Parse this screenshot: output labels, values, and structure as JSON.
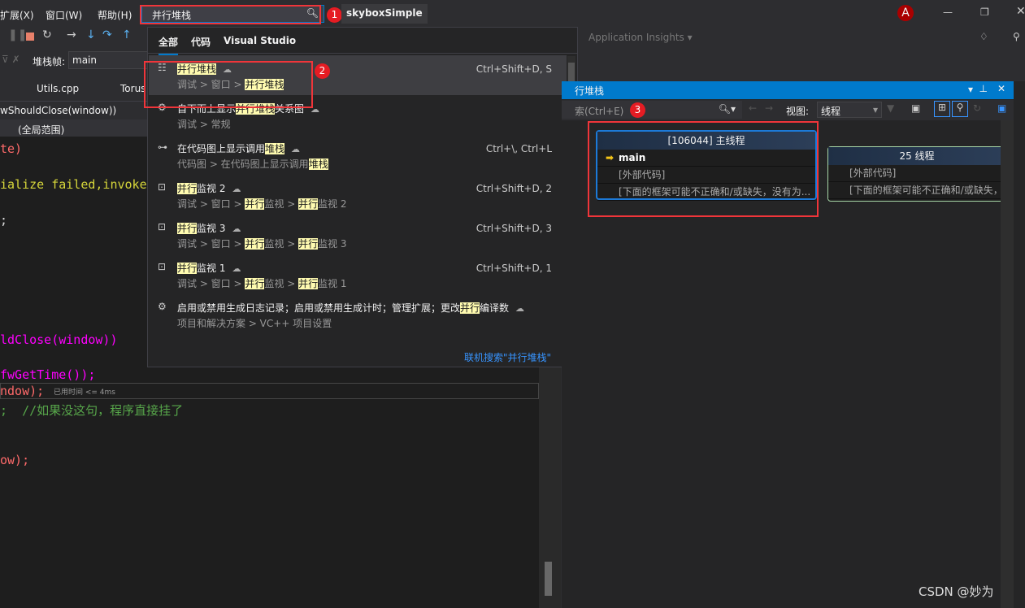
{
  "menu": {
    "items": [
      "扩展(X)",
      "窗口(W)",
      "帮助(H)"
    ]
  },
  "search": {
    "value": "并行堆栈",
    "badge": "1"
  },
  "solution_name": "skyboxSimple",
  "user_avatar": "A",
  "app_insights": "Application Insights",
  "stack_frame": {
    "label": "堆栈帧:",
    "value": "main"
  },
  "editor_tabs": [
    "Utils.cpp",
    "Torus"
  ],
  "nav": {
    "function": "wShouldClose(window))",
    "scope": "(全局范围)"
  },
  "code_lines": [
    {
      "text": "te)",
      "color": "#ff6a6a"
    },
    {
      "text": "ialize failed,invoke",
      "color": "#d6d63a"
    },
    {
      "text": ";",
      "color": "#dcdcdc"
    },
    {
      "text": "ldClose(window))",
      "color": "#ff00ff"
    },
    {
      "text": "fwGetTime());",
      "color": "#ff00ff"
    },
    {
      "text": "ndow);",
      "color": "#ff6a6a"
    },
    {
      "text": ";  //如果没这句，程序直接挂了",
      "color": "#57a64a"
    },
    {
      "text": "ow);",
      "color": "#ff6a6a"
    }
  ],
  "perf_tip": "已用时间 <= 4ms",
  "popup": {
    "tabs": [
      "全部",
      "代码",
      "Visual Studio"
    ],
    "badge": "2",
    "items": [
      {
        "icon": "parallel-stacks-icon",
        "title": [
          {
            "t": "并行堆栈",
            "h": true
          }
        ],
        "path": [
          {
            "t": "调试 > 窗口 > "
          },
          {
            "t": "并行堆栈",
            "h": true
          }
        ],
        "shortcut": "Ctrl+Shift+D, S"
      },
      {
        "icon": "gear-icon",
        "title": [
          {
            "t": "自下而上显示"
          },
          {
            "t": "并行堆栈",
            "h": true
          },
          {
            "t": "关系图"
          }
        ],
        "path": [
          {
            "t": "调试 > 常规"
          }
        ],
        "shortcut": ""
      },
      {
        "icon": "code-map-icon",
        "title": [
          {
            "t": "在代码图上显示调用"
          },
          {
            "t": "堆栈",
            "h": true
          }
        ],
        "path": [
          {
            "t": "代码图 > 在代码图上显示调用"
          },
          {
            "t": "堆栈",
            "h": true
          }
        ],
        "shortcut": "Ctrl+\\, Ctrl+L"
      },
      {
        "icon": "parallel-watch-icon",
        "title": [
          {
            "t": "并行",
            "h": true
          },
          {
            "t": "监视 2"
          }
        ],
        "path": [
          {
            "t": "调试 > 窗口 > "
          },
          {
            "t": "并行",
            "h": true
          },
          {
            "t": "监视 > "
          },
          {
            "t": "并行",
            "h": true
          },
          {
            "t": "监视 2"
          }
        ],
        "shortcut": "Ctrl+Shift+D, 2"
      },
      {
        "icon": "parallel-watch-icon",
        "title": [
          {
            "t": "并行",
            "h": true
          },
          {
            "t": "监视 3"
          }
        ],
        "path": [
          {
            "t": "调试 > 窗口 > "
          },
          {
            "t": "并行",
            "h": true
          },
          {
            "t": "监视 > "
          },
          {
            "t": "并行",
            "h": true
          },
          {
            "t": "监视 3"
          }
        ],
        "shortcut": "Ctrl+Shift+D, 3"
      },
      {
        "icon": "parallel-watch-icon",
        "title": [
          {
            "t": "并行",
            "h": true
          },
          {
            "t": "监视 1"
          }
        ],
        "path": [
          {
            "t": "调试 > 窗口 > "
          },
          {
            "t": "并行",
            "h": true
          },
          {
            "t": "监视 > "
          },
          {
            "t": "并行",
            "h": true
          },
          {
            "t": "监视 1"
          }
        ],
        "shortcut": "Ctrl+Shift+D, 1"
      },
      {
        "icon": "gear-icon",
        "title": [
          {
            "t": "启用或禁用生成日志记录；启用或禁用生成计时；管理扩展；更改"
          },
          {
            "t": "并行",
            "h": true
          },
          {
            "t": "编译数"
          }
        ],
        "path": [
          {
            "t": "项目和解决方案 > VC++ 项目设置"
          }
        ],
        "shortcut": ""
      }
    ],
    "online_search": "联机搜索\"并行堆栈\""
  },
  "parallel_stacks": {
    "title": "行堆栈",
    "search_placeholder": "索(Ctrl+E)",
    "badge": "3",
    "view_label": "视图:",
    "view_value": "线程",
    "cards": [
      {
        "header": "[106044] 主线程",
        "rows": [
          "main",
          "[外部代码]",
          "[下面的框架可能不正确和/或缺失，没有为..."
        ]
      },
      {
        "header": "25 线程",
        "rows": [
          "[外部代码]",
          "[下面的框架可能不正确和/或缺失，"
        ]
      }
    ]
  },
  "watermark": "CSDN @妙为",
  "colors": {
    "accent": "#007acc",
    "highlight": "#fffbb0",
    "annotation": "#f0353a"
  }
}
